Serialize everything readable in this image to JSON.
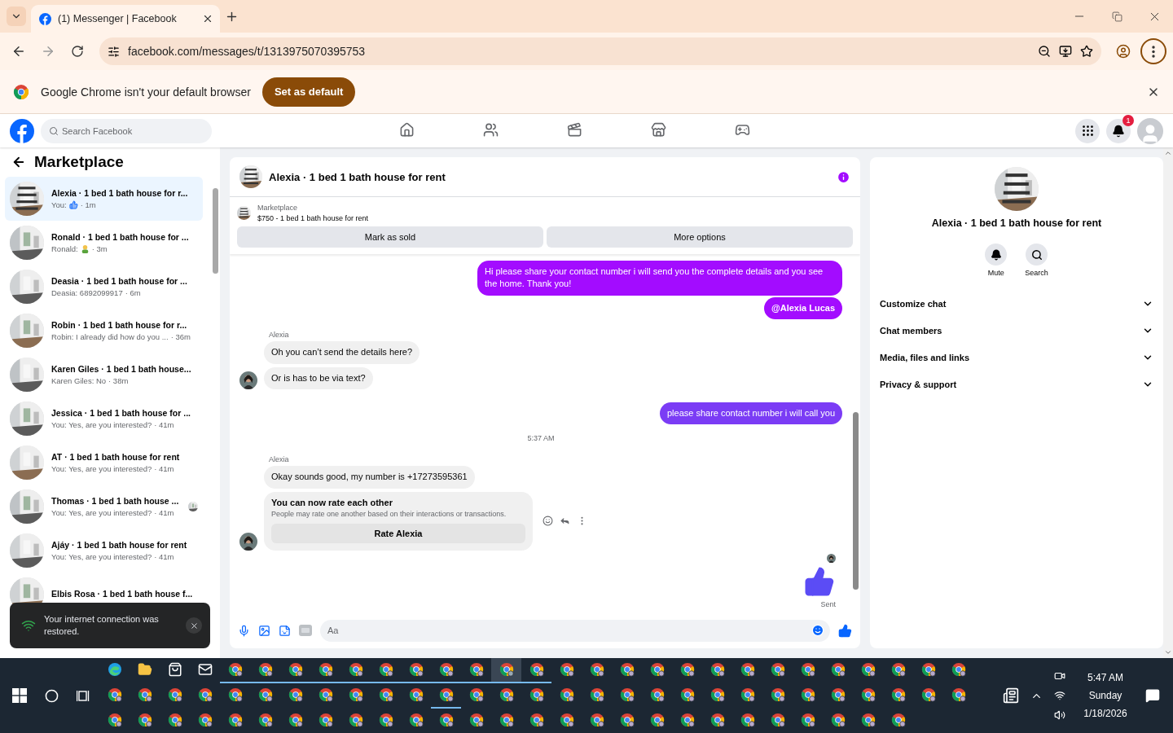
{
  "browser": {
    "tab": {
      "title": "(1) Messenger | Facebook",
      "selected": true
    },
    "url": "facebook.com/messages/t/1313975070395753",
    "infobar": {
      "message": "Google Chrome isn't your default browser",
      "button": "Set as default"
    }
  },
  "facebook": {
    "search_placeholder": "Search Facebook",
    "nav": [
      {
        "kind": "home",
        "selected": false
      },
      {
        "kind": "friends",
        "selected": false
      },
      {
        "kind": "video",
        "selected": false
      },
      {
        "kind": "marketplace",
        "selected": false
      },
      {
        "kind": "gaming",
        "selected": false
      }
    ],
    "notifications_badge": "1"
  },
  "sidebar": {
    "title": "Marketplace",
    "conversations": [
      {
        "title": "Alexia · 1 bed 1 bath house for r...",
        "preview": "You:",
        "preview_emoji": {
          "kind": "thumb"
        },
        "time": "· 1m",
        "selected": true,
        "seen": false
      },
      {
        "title": "Ronald · 1 bed 1 bath house for ...",
        "preview": "Ronald:",
        "preview_emoji": {
          "kind": "person"
        },
        "time": "· 3m",
        "selected": false,
        "seen": false
      },
      {
        "title": "Deasia · 1 bed 1 bath house for ...",
        "preview": "Deasia: 6892099917",
        "time": "· 6m",
        "selected": false,
        "seen": false
      },
      {
        "title": "Robin · 1 bed 1 bath house for r...",
        "preview": "Robin: I already did how do you ...",
        "time": "· 36m",
        "selected": false,
        "seen": false
      },
      {
        "title": "Karen Giles · 1 bed 1 bath house...",
        "preview": "Karen Giles: No",
        "time": "· 38m",
        "selected": false,
        "seen": false
      },
      {
        "title": "Jessica · 1 bed 1 bath house for ...",
        "preview": "You: Yes, are you interested?",
        "time": "· 41m",
        "selected": false,
        "seen": false
      },
      {
        "title": "AT · 1 bed 1 bath house for rent",
        "preview": "You: Yes, are you interested?",
        "time": "· 41m",
        "selected": false,
        "seen": false
      },
      {
        "title": "Thomas · 1 bed 1 bath house ...",
        "preview": "You: Yes, are you interested?",
        "time": "· 41m",
        "selected": false,
        "seen": true
      },
      {
        "title": "Ajáy · 1 bed 1 bath house for rent",
        "preview": "You: Yes, are you interested?",
        "time": "· 41m",
        "selected": false,
        "seen": false
      },
      {
        "title": "Elbis Rosa · 1 bed 1 bath house f...",
        "selected": false,
        "seen": false
      }
    ]
  },
  "toast": {
    "message": "Your internet connection was restored."
  },
  "chat": {
    "title": "Alexia · 1 bed 1 bath house for rent",
    "listing": {
      "label": "Marketplace",
      "title": "$750 - 1 bed 1 bath house for rent",
      "buttons": [
        "Mark as sold",
        "More options"
      ]
    },
    "messages": [
      {
        "kind": "outgoing",
        "text": "Hi please share your contact number i will send you the complete details and you see the home. Thank you!",
        "color": "#a30cff"
      },
      {
        "kind": "mention",
        "text": "@Alexia Lucas",
        "color": "#a30cff"
      },
      {
        "kind": "sender",
        "text": "Alexia"
      },
      {
        "kind": "incoming",
        "text": "Oh you can’t send the details here?",
        "avatar": false
      },
      {
        "kind": "incoming",
        "text": "Or is has to be via text?",
        "avatar": true
      },
      {
        "kind": "outgoing",
        "text": "please share contact number i will call you",
        "color": "#7b3cf5"
      },
      {
        "kind": "timestamp",
        "text": "5:37 AM"
      },
      {
        "kind": "sender",
        "text": "Alexia"
      },
      {
        "kind": "incoming",
        "text": "Okay sounds good, my number is +17273595361",
        "avatar": false
      },
      {
        "kind": "rating",
        "title": "You can now rate each other",
        "text": "People may rate one another based on their interactions or transactions.",
        "button": "Rate Alexia",
        "avatar": true
      },
      {
        "kind": "like",
        "status": "Sent",
        "color": "#5b4cf5",
        "seen": true
      }
    ],
    "composer": {
      "placeholder": "Aa"
    }
  },
  "details": {
    "title": "Alexia · 1 bed 1 bath house for rent",
    "actions": [
      {
        "kind": "bell",
        "label": "Mute"
      },
      {
        "kind": "search",
        "label": "Search"
      }
    ],
    "sections": [
      {
        "label": "Customize chat",
        "expanded": false
      },
      {
        "label": "Chat members",
        "expanded": false
      },
      {
        "label": "Media, files and links",
        "expanded": false
      },
      {
        "label": "Privacy & support",
        "expanded": false
      }
    ]
  },
  "taskbar": {
    "rows": [
      [
        {
          "kind": "edge",
          "running": false,
          "selected": false
        },
        {
          "kind": "explorer",
          "running": false,
          "selected": false
        },
        {
          "kind": "store",
          "running": false,
          "selected": false
        },
        {
          "kind": "mail",
          "running": false,
          "selected": false
        },
        {
          "kind": "chrome",
          "running": true,
          "selected": false
        },
        {
          "kind": "chrome",
          "running": true,
          "selected": false
        },
        {
          "kind": "chrome",
          "running": true,
          "selected": false
        },
        {
          "kind": "chrome",
          "running": true,
          "selected": false
        },
        {
          "kind": "chrome",
          "running": true,
          "selected": false
        },
        {
          "kind": "chrome",
          "running": true,
          "selected": false
        },
        {
          "kind": "chrome",
          "running": true,
          "selected": false
        },
        {
          "kind": "chrome",
          "running": true,
          "selected": false
        },
        {
          "kind": "chrome",
          "running": true,
          "selected": false
        },
        {
          "kind": "chrome",
          "running": true,
          "selected": true
        },
        {
          "kind": "chrome",
          "running": true,
          "selected": false
        },
        {
          "kind": "chrome",
          "running": false,
          "selected": false
        },
        {
          "kind": "chrome",
          "running": false,
          "selected": false
        },
        {
          "kind": "chrome",
          "running": false,
          "selected": false
        },
        {
          "kind": "chrome",
          "running": false,
          "selected": false
        },
        {
          "kind": "chrome",
          "running": false,
          "selected": false
        },
        {
          "kind": "chrome",
          "running": false,
          "selected": false
        },
        {
          "kind": "chrome",
          "running": false,
          "selected": false
        },
        {
          "kind": "chrome",
          "running": false,
          "selected": false
        },
        {
          "kind": "chrome",
          "running": false,
          "selected": false
        },
        {
          "kind": "chrome",
          "running": false,
          "selected": false
        },
        {
          "kind": "chrome",
          "running": false,
          "selected": false
        },
        {
          "kind": "chrome",
          "running": false,
          "selected": false
        },
        {
          "kind": "chrome",
          "running": false,
          "selected": false
        },
        {
          "kind": "chrome",
          "running": false,
          "selected": false
        }
      ],
      [
        {
          "kind": "chrome",
          "running": false,
          "selected": false
        },
        {
          "kind": "chrome",
          "running": false,
          "selected": false
        },
        {
          "kind": "chrome",
          "running": false,
          "selected": false
        },
        {
          "kind": "chrome",
          "running": false,
          "selected": false
        },
        {
          "kind": "chrome",
          "running": false,
          "selected": false
        },
        {
          "kind": "chrome",
          "running": false,
          "selected": false
        },
        {
          "kind": "chrome",
          "running": false,
          "selected": false
        },
        {
          "kind": "chrome",
          "running": false,
          "selected": false
        },
        {
          "kind": "chrome",
          "running": false,
          "selected": false
        },
        {
          "kind": "chrome",
          "running": false,
          "selected": false
        },
        {
          "kind": "chrome",
          "running": false,
          "selected": false
        },
        {
          "kind": "chrome",
          "running": true,
          "selected": false
        },
        {
          "kind": "chrome",
          "running": false,
          "selected": false
        },
        {
          "kind": "chrome",
          "running": false,
          "selected": false
        },
        {
          "kind": "chrome",
          "running": false,
          "selected": false
        },
        {
          "kind": "chrome",
          "running": false,
          "selected": false
        },
        {
          "kind": "chrome",
          "running": false,
          "selected": false
        },
        {
          "kind": "chrome",
          "running": false,
          "selected": false
        },
        {
          "kind": "chrome",
          "running": false,
          "selected": false
        },
        {
          "kind": "chrome",
          "running": false,
          "selected": false
        },
        {
          "kind": "chrome",
          "running": false,
          "selected": false
        },
        {
          "kind": "chrome",
          "running": false,
          "selected": false
        },
        {
          "kind": "chrome",
          "running": false,
          "selected": false
        },
        {
          "kind": "chrome",
          "running": false,
          "selected": false
        },
        {
          "kind": "chrome",
          "running": false,
          "selected": false
        },
        {
          "kind": "chrome",
          "running": false,
          "selected": false
        },
        {
          "kind": "chrome",
          "running": false,
          "selected": false
        },
        {
          "kind": "chrome",
          "running": false,
          "selected": false
        },
        {
          "kind": "chrome",
          "running": false,
          "selected": false
        }
      ],
      [
        {
          "kind": "chrome",
          "running": false,
          "selected": false
        },
        {
          "kind": "chrome",
          "running": false,
          "selected": false
        },
        {
          "kind": "chrome",
          "running": false,
          "selected": false
        },
        {
          "kind": "chrome",
          "running": false,
          "selected": false
        },
        {
          "kind": "chrome",
          "running": false,
          "selected": false
        },
        {
          "kind": "chrome",
          "running": false,
          "selected": false
        },
        {
          "kind": "chrome",
          "running": false,
          "selected": false
        },
        {
          "kind": "chrome",
          "running": false,
          "selected": false
        },
        {
          "kind": "chrome",
          "running": false,
          "selected": false
        },
        {
          "kind": "chrome",
          "running": false,
          "selected": false
        },
        {
          "kind": "chrome",
          "running": false,
          "selected": false
        },
        {
          "kind": "chrome",
          "running": false,
          "selected": false
        },
        {
          "kind": "chrome",
          "running": false,
          "selected": false
        },
        {
          "kind": "chrome",
          "running": false,
          "selected": false
        },
        {
          "kind": "chrome",
          "running": false,
          "selected": false
        },
        {
          "kind": "chrome",
          "running": false,
          "selected": false
        },
        {
          "kind": "chrome",
          "running": false,
          "selected": false
        },
        {
          "kind": "chrome",
          "running": false,
          "selected": false
        },
        {
          "kind": "chrome",
          "running": false,
          "selected": false
        },
        {
          "kind": "chrome",
          "running": false,
          "selected": false
        },
        {
          "kind": "chrome",
          "running": false,
          "selected": false
        },
        {
          "kind": "chrome",
          "running": false,
          "selected": false
        },
        {
          "kind": "chrome",
          "running": false,
          "selected": false
        },
        {
          "kind": "chrome",
          "running": false,
          "selected": false
        },
        {
          "kind": "chrome",
          "running": false,
          "selected": false
        },
        {
          "kind": "chrome",
          "running": false,
          "selected": false
        },
        {
          "kind": "chrome",
          "running": false,
          "selected": false
        }
      ]
    ],
    "clock": {
      "time": "5:47 AM",
      "day": "Sunday",
      "date": "1/18/2026"
    }
  }
}
